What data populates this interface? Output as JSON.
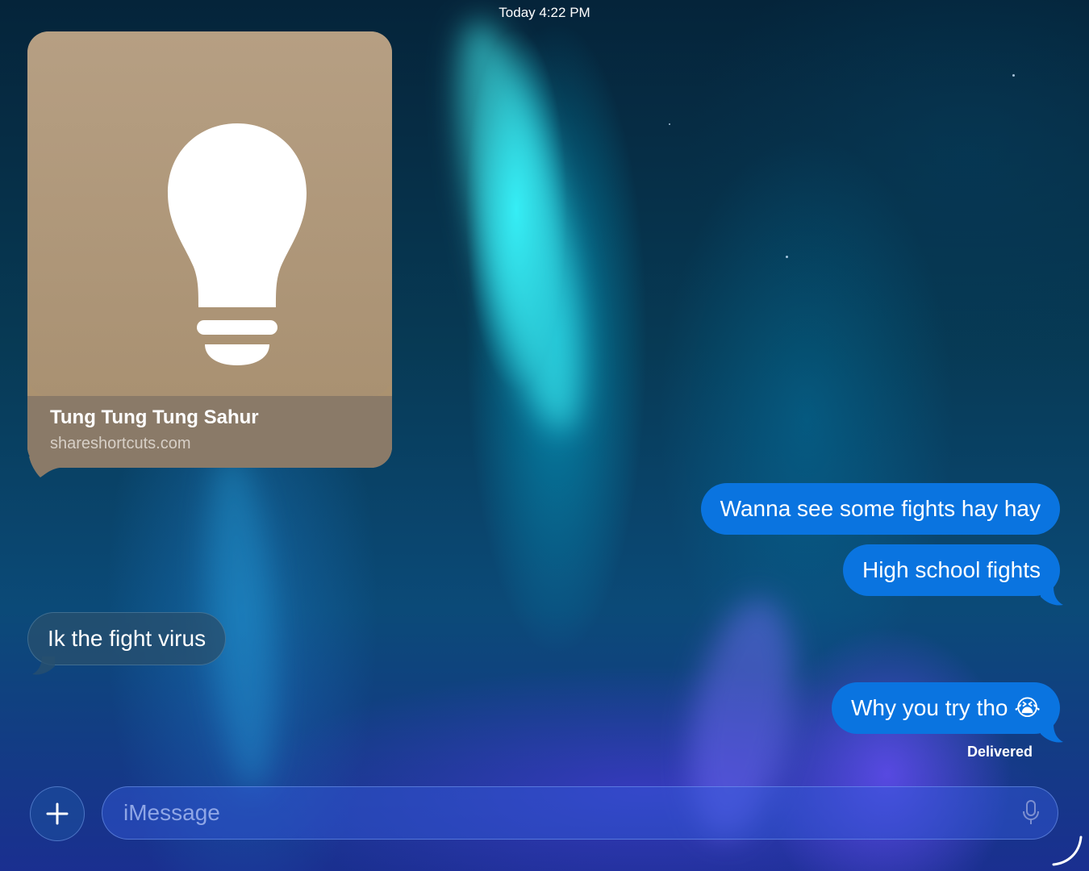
{
  "header": {
    "timestamp": "Today 4:22 PM"
  },
  "link_preview": {
    "title": "Tung Tung Tung Sahur",
    "domain": "shareshortcuts.com",
    "icon": "lightbulb-icon",
    "background_color": "#ab9270"
  },
  "messages": [
    {
      "direction": "sent",
      "text": "Wanna see some fights hay hay"
    },
    {
      "direction": "sent",
      "text": "High school fights"
    },
    {
      "direction": "received",
      "text": "Ik the fight virus"
    },
    {
      "direction": "sent",
      "text": "Why you try tho 😭"
    }
  ],
  "status": {
    "delivered": "Delivered"
  },
  "composer": {
    "placeholder": "iMessage",
    "add_icon": "plus-icon",
    "mic_icon": "microphone-icon"
  },
  "colors": {
    "sent_bubble": "#0a74e0",
    "received_bubble": "#28506e"
  }
}
